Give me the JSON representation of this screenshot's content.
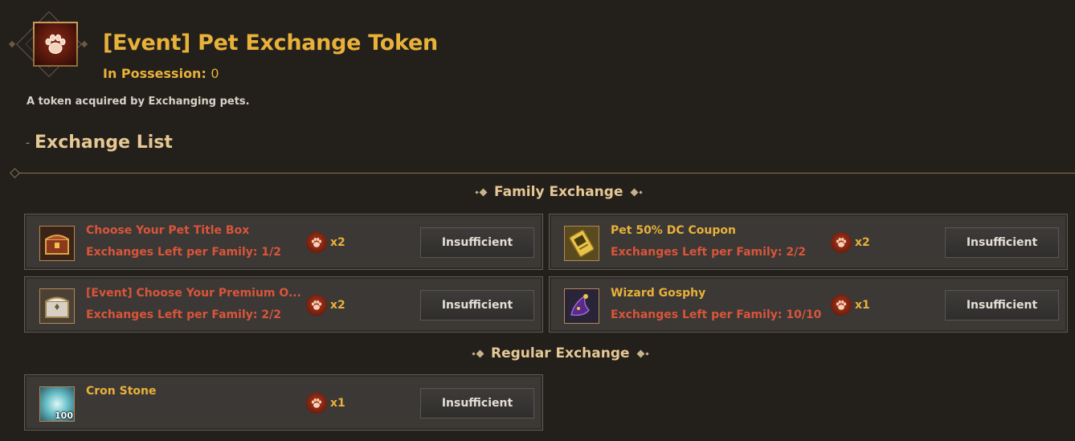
{
  "header": {
    "title": "[Event] Pet Exchange Token",
    "possession_label": "In Possession:",
    "possession_value": "0",
    "description": "A token acquired by Exchanging pets."
  },
  "exchange_list": {
    "heading": "Exchange List"
  },
  "sections": {
    "family": "Family Exchange",
    "regular": "Regular Exchange"
  },
  "items": [
    {
      "name": "Choose Your Pet Title Box",
      "left_label": "Exchanges Left per Family:",
      "left_value": "1/2",
      "qty": "x2",
      "button": "Insufficient",
      "icon": "treasure-chest-icon",
      "name_color": "#d9553a"
    },
    {
      "name": "Pet 50% DC Coupon",
      "left_label": "Exchanges Left per Family:",
      "left_value": "2/2",
      "qty": "x2",
      "button": "Insufficient",
      "icon": "coupon-icon",
      "name_color": "#e8b13a"
    },
    {
      "name": "[Event] Choose Your Premium O...",
      "left_label": "Exchanges Left per Family:",
      "left_value": "2/2",
      "qty": "x2",
      "button": "Insufficient",
      "icon": "premium-box-icon",
      "name_color": "#d9553a"
    },
    {
      "name": "Wizard Gosphy",
      "left_label": "Exchanges Left per Family:",
      "left_value": "10/10",
      "qty": "x1",
      "button": "Insufficient",
      "icon": "wizard-hat-icon",
      "name_color": "#e8b13a"
    },
    {
      "name": "Cron Stone",
      "qty": "x1",
      "button": "Insufficient",
      "icon": "cron-stone-icon",
      "badge": "100",
      "name_color": "#e8b13a"
    }
  ],
  "colors": {
    "accent": "#e8b13a",
    "unavailable": "#d9553a",
    "background": "#231f1b"
  }
}
